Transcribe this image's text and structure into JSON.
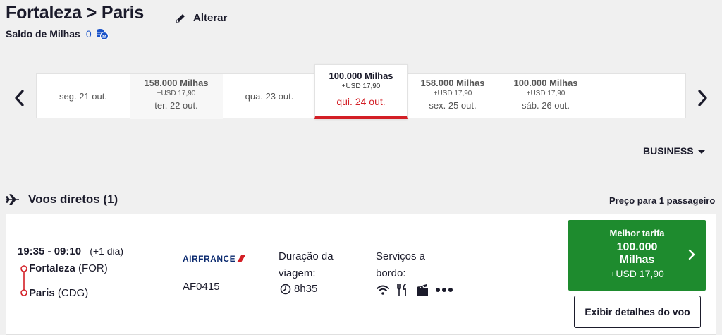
{
  "header": {
    "origin": "Fortaleza",
    "separator": ">",
    "destination": "Paris",
    "edit_label": "Alterar",
    "balance_label": "Saldo de Milhas",
    "balance_value": "0"
  },
  "dates": [
    {
      "miles": "",
      "usd": "",
      "date": "seg. 21 out.",
      "state": "plain"
    },
    {
      "miles": "158.000 Milhas",
      "usd": "+USD 17,90",
      "date": "ter. 22 out.",
      "state": "grey"
    },
    {
      "miles": "",
      "usd": "",
      "date": "qua. 23 out.",
      "state": "plain"
    },
    {
      "miles": "100.000 Milhas",
      "usd": "+USD 17,90",
      "date": "qui. 24 out.",
      "state": "selected"
    },
    {
      "miles": "158.000 Milhas",
      "usd": "+USD 17,90",
      "date": "sex. 25 out.",
      "state": "normal"
    },
    {
      "miles": "100.000 Milhas",
      "usd": "+USD 17,90",
      "date": "sáb. 26 out.",
      "state": "normal"
    }
  ],
  "cabin": {
    "selected": "BUSINESS"
  },
  "section": {
    "title": "Voos diretos (1)",
    "price_note": "Preço para 1 passageiro"
  },
  "flight": {
    "time": "19:35 - 09:10",
    "day_offset": "(+1 dia)",
    "origin_city": "Fortaleza",
    "origin_code": "(FOR)",
    "dest_city": "Paris",
    "dest_code": "(CDG)",
    "airline_name": "AIRFRANCE",
    "flight_number": "AF0415",
    "duration_label": "Duração da viagem:",
    "duration_value": "8h35",
    "services_label": "Serviços a bordo:",
    "services_icons": [
      "wifi-icon",
      "meal-icon",
      "entertainment-icon",
      "more-icon"
    ]
  },
  "fare": {
    "label": "Melhor tarifa",
    "miles_line1": "100.000",
    "miles_line2": "Milhas",
    "usd": "+USD 17,90",
    "details_label": "Exibir detalhes do voo"
  },
  "colors": {
    "accent_red": "#d31f26",
    "green": "#1e8b2e",
    "navy": "#1b1b2b",
    "link_blue": "#1a53c9"
  }
}
